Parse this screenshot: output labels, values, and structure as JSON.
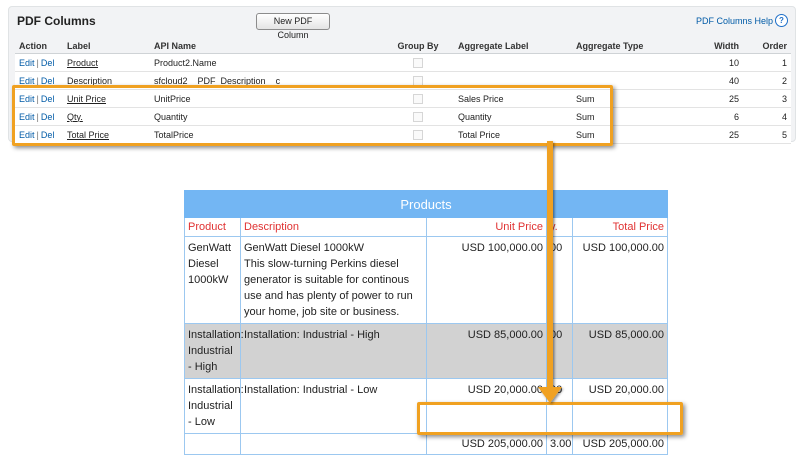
{
  "panel": {
    "title": "PDF Columns",
    "new_button": "New PDF Column",
    "help_link": "PDF Columns Help",
    "help_icon": "?"
  },
  "columns_table": {
    "headers": [
      "Action",
      "Label",
      "API Name",
      "Group By",
      "Aggregate Label",
      "Aggregate Type",
      "Width",
      "Order"
    ],
    "edit_label": "Edit",
    "separator": "|",
    "del_label": "Del",
    "rows": [
      {
        "label": "Product",
        "api": "Product2.Name",
        "agg_label": "",
        "agg_type": "",
        "width": "10",
        "order": "1"
      },
      {
        "label": "Description",
        "api": "sfcloud2__PDF_Description__c",
        "agg_label": "",
        "agg_type": "",
        "width": "40",
        "order": "2"
      },
      {
        "label": "Unit Price",
        "api": "UnitPrice",
        "agg_label": "Sales Price",
        "agg_type": "Sum",
        "width": "25",
        "order": "3"
      },
      {
        "label": "Qty.",
        "api": "Quantity",
        "agg_label": "Quantity",
        "agg_type": "Sum",
        "width": "6",
        "order": "4"
      },
      {
        "label": "Total Price",
        "api": "TotalPrice",
        "agg_label": "Total Price",
        "agg_type": "Sum",
        "width": "25",
        "order": "5"
      }
    ]
  },
  "preview": {
    "title": "Products",
    "headers": [
      "Product",
      "Description",
      "Unit Price",
      "y.",
      "Total Price"
    ],
    "rows": [
      {
        "product": "GenWatt Diesel 1000kW",
        "description": "GenWatt Diesel 1000kW This slow-turning Perkins diesel generator is suitable for continous use and has plenty of power to run your home, job site or business.",
        "unit_price": "USD 100,000.00",
        "qty": "00",
        "total": "USD 100,000.00"
      },
      {
        "product": "Installation: Industrial - High",
        "description": "Installation: Industrial - High",
        "unit_price": "USD 85,000.00",
        "qty": "00",
        "total": "USD 85,000.00"
      },
      {
        "product": "Installation: Industrial - Low",
        "description": "Installation: Industrial - Low",
        "unit_price": "USD 20,000.00",
        "qty": "00",
        "total": "USD 20,000.00"
      }
    ],
    "totals": {
      "unit_price": "USD 205,000.00",
      "qty": "3.00",
      "total": "USD 205,000.00"
    }
  },
  "colors": {
    "highlight": "#f0a121",
    "preview_header": "#73b6f3",
    "column_header_text": "#e03232",
    "link": "#015ba7"
  }
}
